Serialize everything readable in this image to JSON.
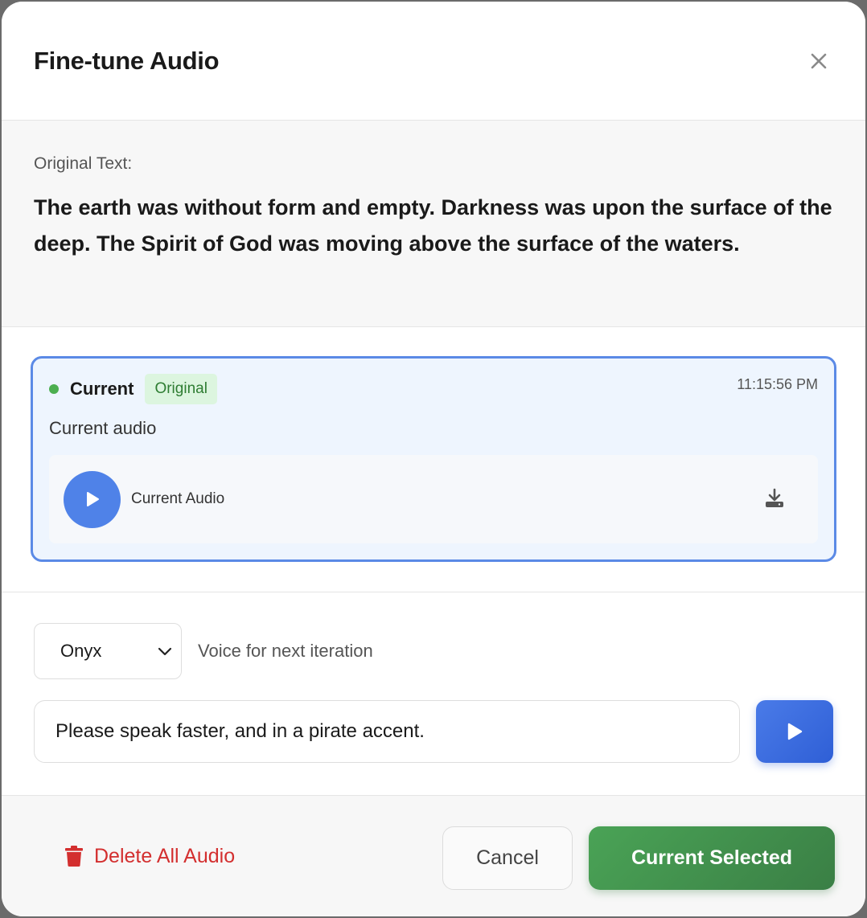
{
  "dialog": {
    "title": "Fine-tune Audio"
  },
  "original": {
    "label": "Original Text:",
    "text": "The earth was without form and empty. Darkness was upon the surface of the deep. The Spirit of God was moving above the surface of the waters."
  },
  "versions": [
    {
      "name": "Current",
      "badge": "Original",
      "timestamp": "11:15:56 PM",
      "description": "Current audio",
      "player_label": "Current Audio",
      "status_color": "#4caf50"
    }
  ],
  "controls": {
    "voice_selected": "Onyx",
    "voice_label": "Voice for next iteration",
    "prompt_value": "Please speak faster, and in a pirate accent."
  },
  "footer": {
    "delete_label": "Delete All Audio",
    "cancel_label": "Cancel",
    "select_label": "Current Selected"
  },
  "icons": {
    "close": "close-icon",
    "play": "play-icon",
    "download": "download-icon",
    "chevron": "chevron-down-icon",
    "trash": "trash-icon"
  },
  "colors": {
    "accent_blue": "#4f82e8",
    "selected_border": "#5b8ae6",
    "success_green": "#4aa356",
    "danger_red": "#d32f2f"
  }
}
